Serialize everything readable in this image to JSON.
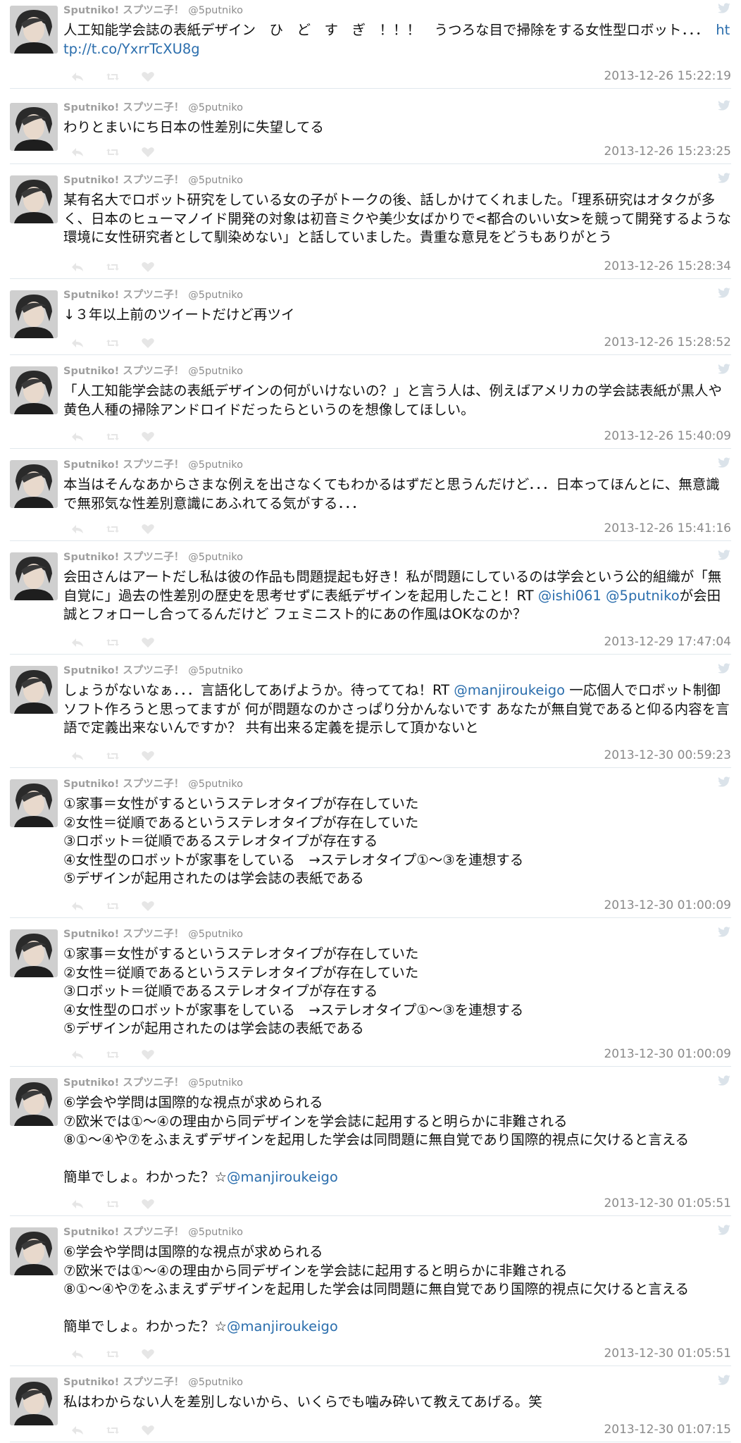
{
  "account": {
    "name": "Sputniko! スプツニ子！",
    "handle": "@5putniko"
  },
  "tweets": [
    {
      "parts": [
        {
          "t": "人工知能学会誌の表紙デザイン　ひ　ど　す　ぎ　！！！　うつろな目で掃除をする女性型ロボット．．．　"
        },
        {
          "t": "http://t.co/YxrrTcXU8g",
          "link": true
        }
      ],
      "time": "2013-12-26 15:22:19"
    },
    {
      "parts": [
        {
          "t": "わりとまいにち日本の性差別に失望してる"
        }
      ],
      "time": "2013-12-26 15:23:25"
    },
    {
      "parts": [
        {
          "t": "某有名大でロボット研究をしている女の子がトークの後、話しかけてくれました。「理系研究はオタクが多く、日本のヒューマノイド開発の対象は初音ミクや美少女ばかりで<都合のいい女>を競って開発するような環境に女性研究者として馴染めない」と話していました。貴重な意見をどうもありがとう"
        }
      ],
      "time": "2013-12-26 15:28:34"
    },
    {
      "parts": [
        {
          "t": "↓３年以上前のツイートだけど再ツイ"
        }
      ],
      "time": "2013-12-26 15:28:52"
    },
    {
      "parts": [
        {
          "t": "「人工知能学会誌の表紙デザインの何がいけないの？」と言う人は、例えばアメリカの学会誌表紙が黒人や黄色人種の掃除アンドロイドだったらというのを想像してほしい。"
        }
      ],
      "time": "2013-12-26 15:40:09"
    },
    {
      "parts": [
        {
          "t": "本当はそんなあからさまな例えを出さなくてもわかるはずだと思うんだけど．．．日本ってほんとに、無意識で無邪気な性差別意識にあふれてる気がする．．．"
        }
      ],
      "time": "2013-12-26 15:41:16"
    },
    {
      "parts": [
        {
          "t": "会田さんはアートだし私は彼の作品も問題提起も好き！私が問題にしているのは学会という公的組織が「無自覚に」過去の性差別の歴史を思考せずに表紙デザインを起用したこと！RT "
        },
        {
          "t": "@ishi061",
          "link": true
        },
        {
          "t": " "
        },
        {
          "t": "@5putniko",
          "link": true
        },
        {
          "t": "が会田誠とフォローし合ってるんだけど フェミニスト的にあの作風はOKなのか？"
        }
      ],
      "time": "2013-12-29 17:47:04"
    },
    {
      "parts": [
        {
          "t": "しょうがないなぁ．．．言語化してあげようか。待っててね！RT "
        },
        {
          "t": "@manjiroukeigo",
          "link": true
        },
        {
          "t": " 一応個人でロボット制御ソフト作ろうと思ってますが 何が問題なのかさっぱり分かんないです あなたが無自覚であると仰る内容を言語で定義出来ないんですか？ 共有出来る定義を提示して頂かないと"
        }
      ],
      "time": "2013-12-30 00:59:23"
    },
    {
      "parts": [
        {
          "t": "①家事＝女性がするというステレオタイプが存在していた\n②女性＝従順であるというステレオタイプが存在していた\n③ロボット＝従順であるステレオタイプが存在する\n④女性型のロボットが家事をしている　→ステレオタイプ①〜③を連想する\n⑤デザインが起用されたのは学会誌の表紙である"
        }
      ],
      "time": "2013-12-30 01:00:09"
    },
    {
      "parts": [
        {
          "t": "①家事＝女性がするというステレオタイプが存在していた\n②女性＝従順であるというステレオタイプが存在していた\n③ロボット＝従順であるステレオタイプが存在する\n④女性型のロボットが家事をしている　→ステレオタイプ①〜③を連想する\n⑤デザインが起用されたのは学会誌の表紙である"
        }
      ],
      "time": "2013-12-30 01:00:09"
    },
    {
      "parts": [
        {
          "t": "⑥学会や学問は国際的な視点が求められる\n⑦欧米では①〜④の理由から同デザインを学会誌に起用すると明らかに非難される\n⑧①〜④や⑦をふまえずデザインを起用した学会は同問題に無自覚であり国際的視点に欠けると言える\n\n簡単でしょ。わかった？☆"
        },
        {
          "t": "@manjiroukeigo",
          "link": true
        }
      ],
      "time": "2013-12-30 01:05:51"
    },
    {
      "parts": [
        {
          "t": "⑥学会や学問は国際的な視点が求められる\n⑦欧米では①〜④の理由から同デザインを学会誌に起用すると明らかに非難される\n⑧①〜④や⑦をふまえずデザインを起用した学会は同問題に無自覚であり国際的視点に欠けると言える\n\n簡単でしょ。わかった？☆"
        },
        {
          "t": "@manjiroukeigo",
          "link": true
        }
      ],
      "time": "2013-12-30 01:05:51"
    },
    {
      "parts": [
        {
          "t": "私はわからない人を差別しないから、いくらでも噛み砕いて教えてあげる。笑"
        }
      ],
      "time": "2013-12-30 01:07:15"
    }
  ],
  "icons": {
    "bird": "twitter-bird-icon",
    "reply": "reply-icon",
    "retweet": "retweet-icon",
    "like": "heart-icon"
  },
  "colors": {
    "link": "#2b6ead",
    "meta": "#8a8a8a",
    "divider": "#e1e8ed"
  }
}
